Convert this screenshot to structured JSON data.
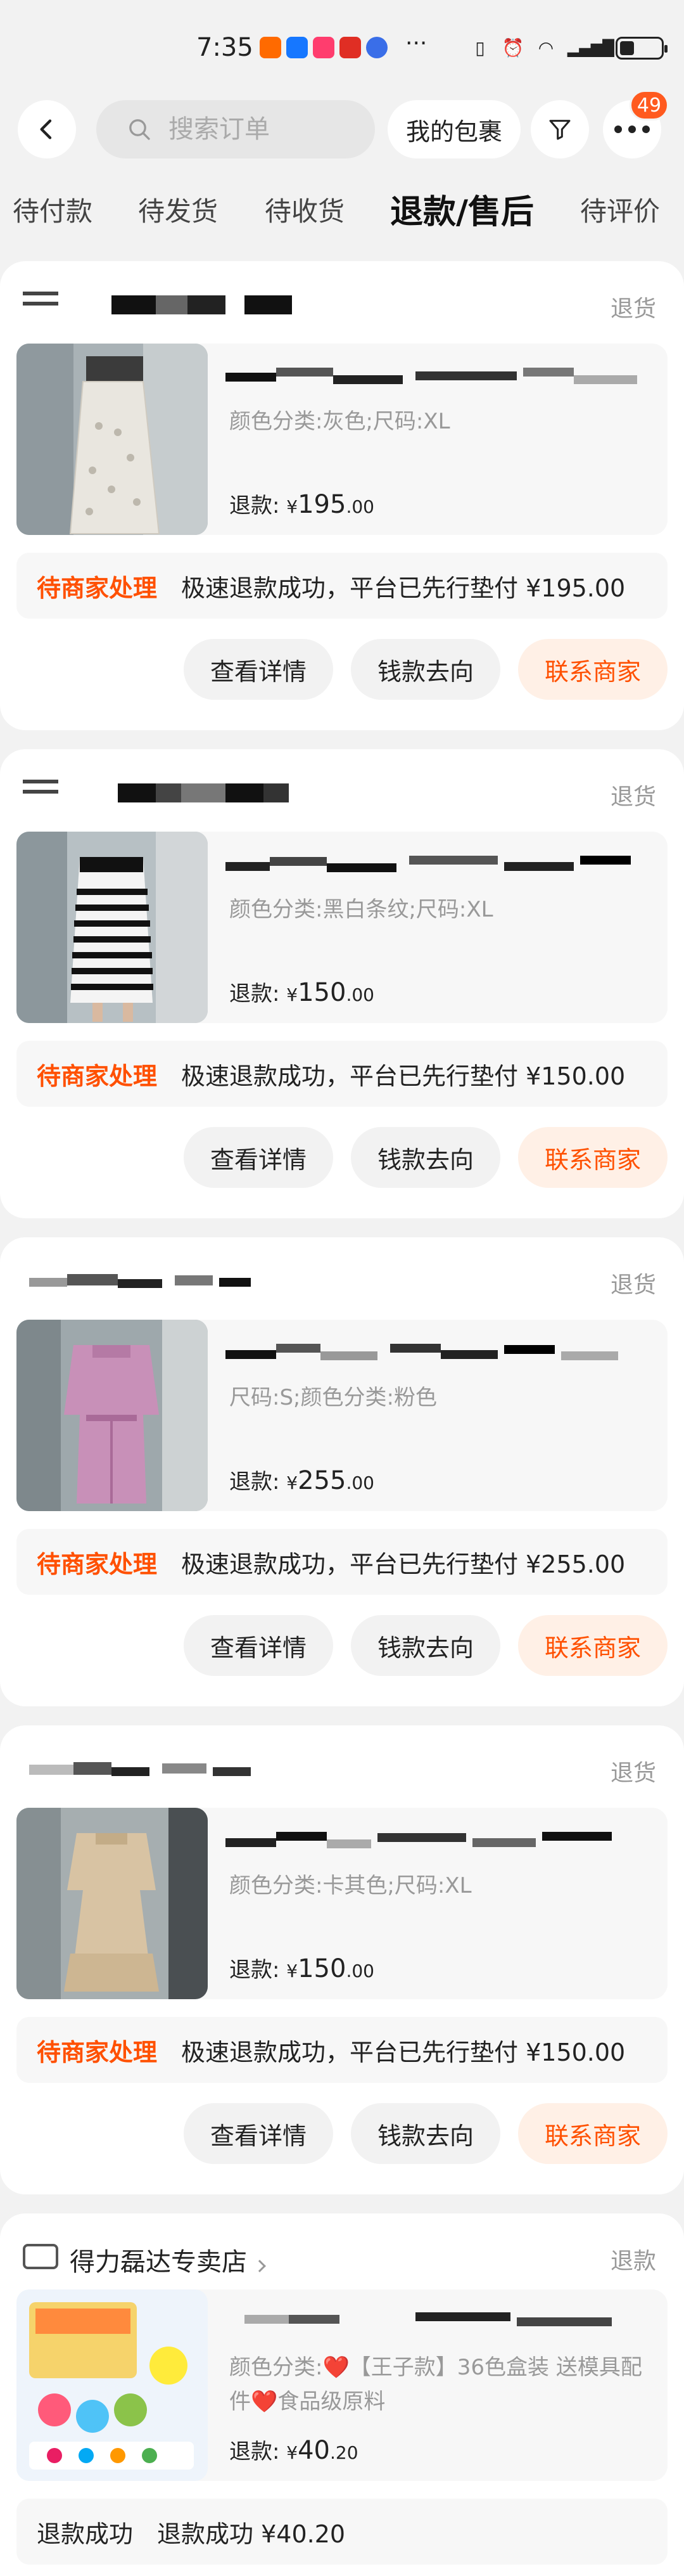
{
  "status_bar": {
    "time": "7:35",
    "more": "···"
  },
  "header": {
    "search_placeholder": "搜索订单",
    "my_package": "我的包裹",
    "badge": "49"
  },
  "tabs": [
    "待付款",
    "待发货",
    "待收货",
    "退款/售后",
    "待评价"
  ],
  "colors": {
    "accent": "#ff5000",
    "badge": "#ff5a1f",
    "page_bg": "#f2f2f2"
  },
  "orders": [
    {
      "shop_name": "",
      "status_tag": "退货",
      "sku": "颜色分类:灰色;尺码:XL",
      "refund_label": "退款:",
      "yen": "¥",
      "amount_int": "195",
      "amount_dec": ".00",
      "status_label": "待商家处理",
      "status_desc": "极速退款成功，平台已先行垫付 ¥195.00",
      "actions": [
        "查看详情",
        "钱款去向",
        "联系商家"
      ]
    },
    {
      "shop_name": "",
      "status_tag": "退货",
      "sku": "颜色分类:黑白条纹;尺码:XL",
      "refund_label": "退款:",
      "yen": "¥",
      "amount_int": "150",
      "amount_dec": ".00",
      "status_label": "待商家处理",
      "status_desc": "极速退款成功，平台已先行垫付 ¥150.00",
      "actions": [
        "查看详情",
        "钱款去向",
        "联系商家"
      ]
    },
    {
      "shop_name": "",
      "status_tag": "退货",
      "sku": "尺码:S;颜色分类:粉色",
      "refund_label": "退款:",
      "yen": "¥",
      "amount_int": "255",
      "amount_dec": ".00",
      "status_label": "待商家处理",
      "status_desc": "极速退款成功，平台已先行垫付 ¥255.00",
      "actions": [
        "查看详情",
        "钱款去向",
        "联系商家"
      ]
    },
    {
      "shop_name": "",
      "status_tag": "退货",
      "sku": "颜色分类:卡其色;尺码:XL",
      "refund_label": "退款:",
      "yen": "¥",
      "amount_int": "150",
      "amount_dec": ".00",
      "status_label": "待商家处理",
      "status_desc": "极速退款成功，平台已先行垫付 ¥150.00",
      "actions": [
        "查看详情",
        "钱款去向",
        "联系商家"
      ]
    },
    {
      "shop_name": "得力磊达专卖店",
      "status_tag": "退款",
      "sku": "颜色分类:❤️【王子款】36色盒装 送模具配件❤️食品级原料",
      "refund_label": "退款:",
      "yen": "¥",
      "amount_int": "40",
      "amount_dec": ".20",
      "status_label": "退款成功",
      "status_desc": "退款成功 ¥40.20"
    }
  ]
}
